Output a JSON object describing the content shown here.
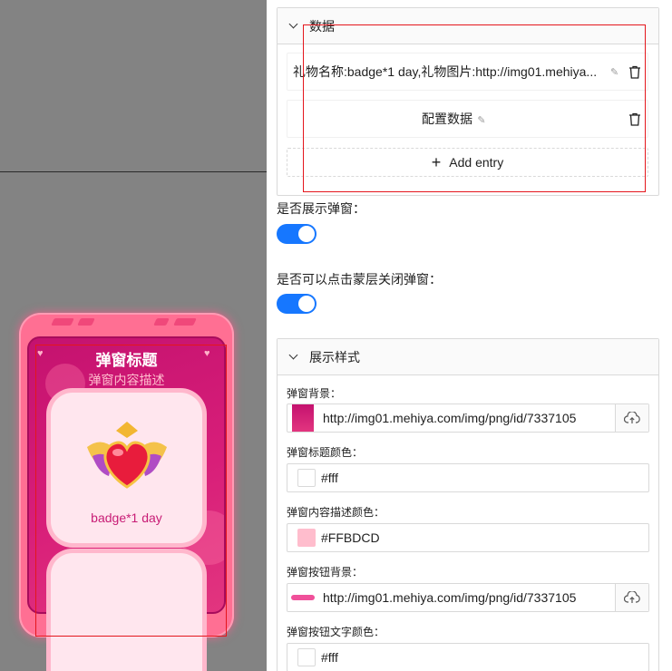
{
  "preview": {
    "popup_title": "弹窗标题",
    "popup_desc": "弹窗内容描述",
    "gift_name": "badge*1 day",
    "colors": {
      "title": "#fff",
      "desc": "#FFBDCD",
      "card": "#ffe6ee",
      "accent": "#c81c75"
    }
  },
  "data_section": {
    "header": "数据",
    "entries": [
      {
        "text": "礼物名称:badge*1 day,礼物图片:http://img01.mehiya..."
      },
      {
        "text": "配置数据"
      }
    ],
    "add_entry_label": "Add entry"
  },
  "toggles": [
    {
      "label": "是否展示弹窗：",
      "on": true
    },
    {
      "label": "是否可以点击蒙层关闭弹窗：",
      "on": true
    }
  ],
  "style_section": {
    "header": "展示样式",
    "fields": [
      {
        "label": "弹窗背景：",
        "value": "http://img01.mehiya.com/img/png/id/7337105"
      },
      {
        "label": "弹窗标题颜色：",
        "value": "#fff",
        "color": "#ffffff"
      },
      {
        "label": "弹窗内容描述颜色：",
        "value": "#FFBDCD",
        "color": "#FFBDCD"
      },
      {
        "label": "弹窗按钮背景：",
        "value": "http://img01.mehiya.com/img/png/id/7337105"
      },
      {
        "label": "弹窗按钮文字颜色：",
        "value": "#fff",
        "color": "#ffffff"
      }
    ]
  }
}
